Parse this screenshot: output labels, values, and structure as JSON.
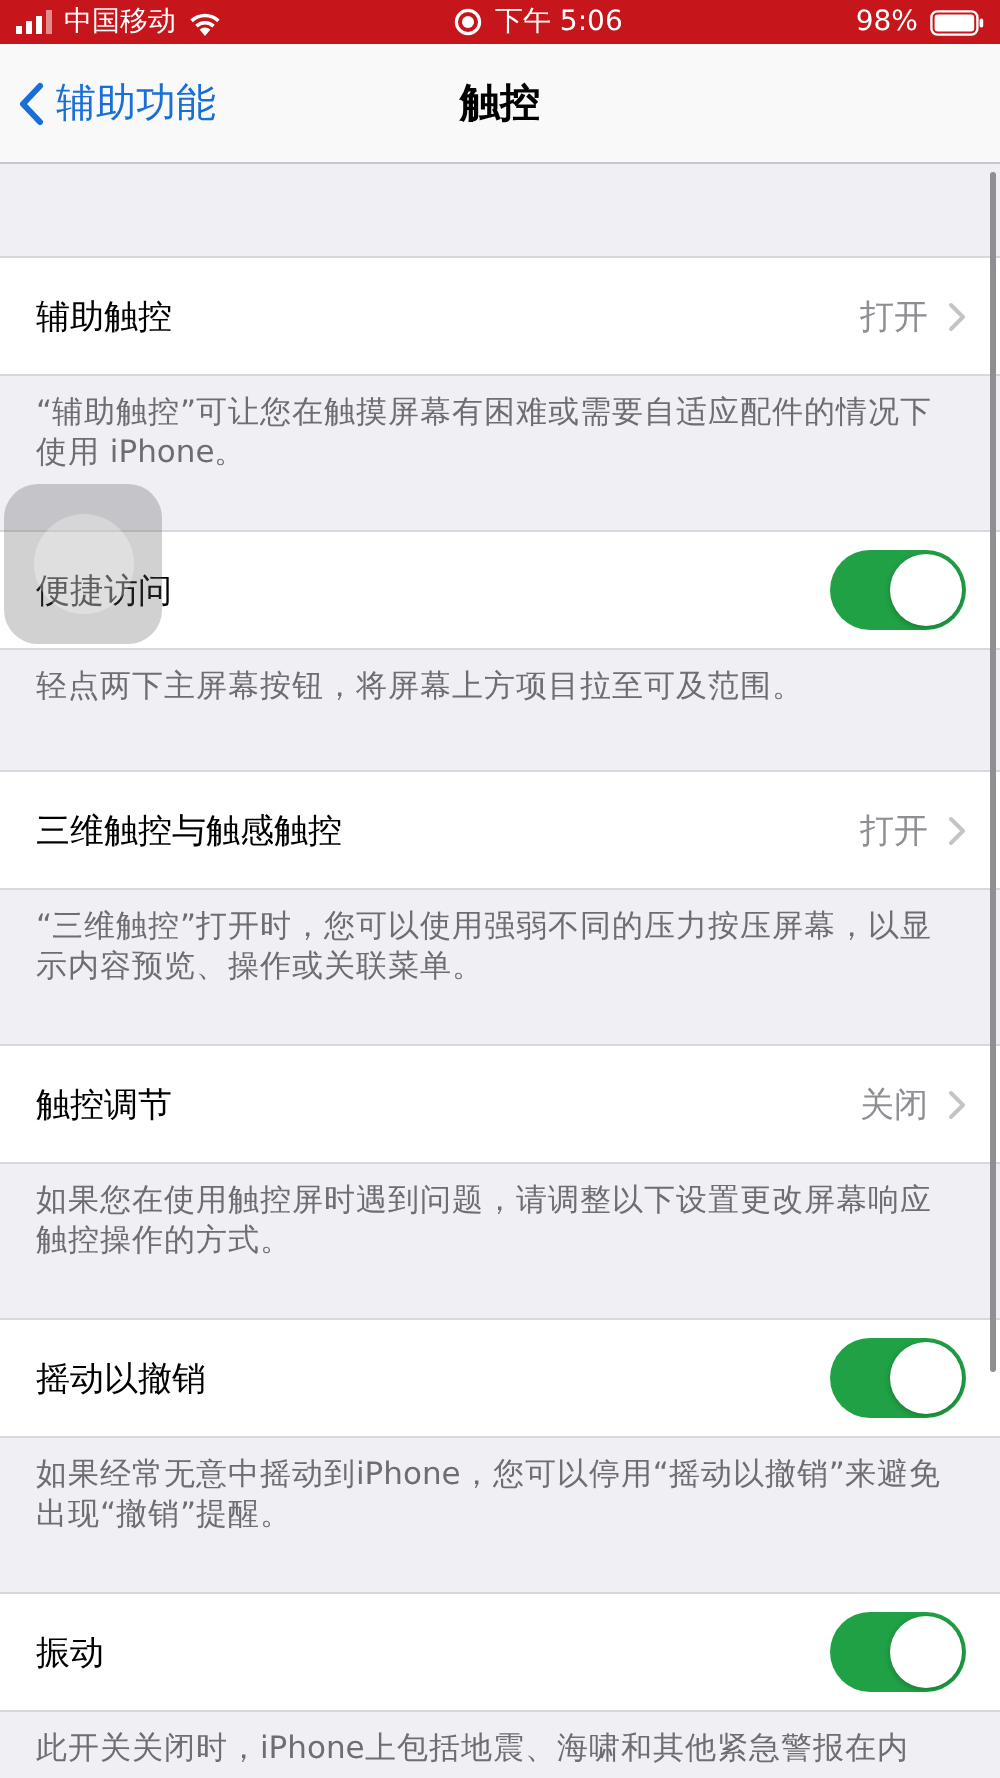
{
  "status_bar": {
    "carrier": "中国移动",
    "time": "下午 5:06",
    "battery": "98%"
  },
  "nav": {
    "back": "辅助功能",
    "title": "触控"
  },
  "sections": [
    {
      "kind": "value",
      "label": "辅助触控",
      "value": "打开",
      "footer": "“辅助触控”可让您在触摸屏幕有困难或需要自适应配件的情况下使用 iPhone。"
    },
    {
      "kind": "toggle",
      "label": "便捷访问",
      "on": true,
      "footer": "轻点两下主屏幕按钮，将屏幕上方项目拉至可及范围。"
    },
    {
      "kind": "value",
      "label": "三维触控与触感触控",
      "value": "打开",
      "footer": "“三维触控”打开时，您可以使用强弱不同的压力按压屏幕，以显示内容预览、操作或关联菜单。"
    },
    {
      "kind": "value",
      "label": "触控调节",
      "value": "关闭",
      "footer": "如果您在使用触控屏时遇到问题，请调整以下设置更改屏幕响应触控操作的方式。"
    },
    {
      "kind": "toggle",
      "label": "摇动以撤销",
      "on": true,
      "footer": "如果经常无意中摇动到iPhone，您可以停用“摇动以撤销”来避免出现“撤销”提醒。"
    },
    {
      "kind": "toggle",
      "label": "振动",
      "on": true,
      "footer": "此开关关闭时，iPhone上包括地震、海啸和其他紧急警报在内"
    }
  ]
}
